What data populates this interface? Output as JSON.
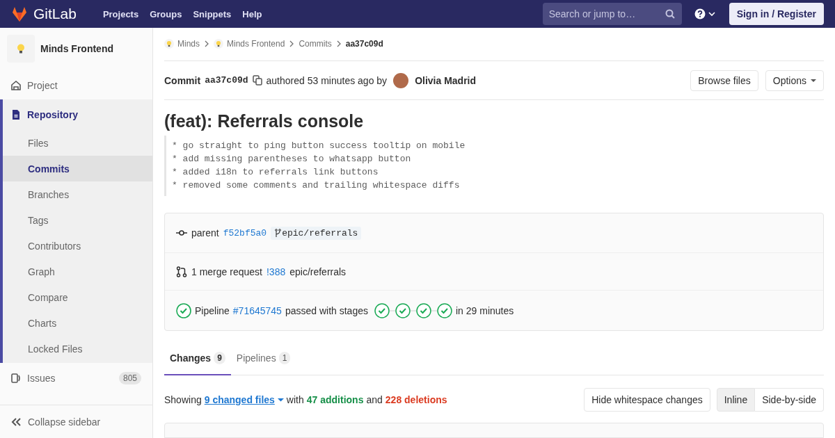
{
  "topbar": {
    "logo": "GitLab",
    "nav": [
      "Projects",
      "Groups",
      "Snippets",
      "Help"
    ],
    "search": {
      "placeholder": "Search or jump to…"
    },
    "signin": "Sign in / Register"
  },
  "sidebar": {
    "project": "Minds Frontend",
    "items": [
      {
        "label": "Project",
        "kind": "project",
        "selected": false
      },
      {
        "label": "Repository",
        "kind": "repository",
        "selected": true,
        "children": [
          {
            "label": "Files",
            "selected": false
          },
          {
            "label": "Commits",
            "selected": true
          },
          {
            "label": "Branches",
            "selected": false
          },
          {
            "label": "Tags",
            "selected": false
          },
          {
            "label": "Contributors",
            "selected": false
          },
          {
            "label": "Graph",
            "selected": false
          },
          {
            "label": "Compare",
            "selected": false
          },
          {
            "label": "Charts",
            "selected": false
          },
          {
            "label": "Locked Files",
            "selected": false
          }
        ]
      },
      {
        "label": "Issues",
        "kind": "issues",
        "selected": false,
        "badge": "805"
      }
    ],
    "collapse": "Collapse sidebar"
  },
  "breadcrumbs": [
    {
      "label": "Minds",
      "avatar": true
    },
    {
      "label": "Minds Frontend",
      "avatar": true
    },
    {
      "label": "Commits",
      "avatar": false
    },
    {
      "label": "aa37c09d",
      "avatar": false
    }
  ],
  "commit_header": {
    "label": "Commit",
    "sha": "aa37c09d",
    "authored": "authored 53 minutes ago by",
    "author": "Olivia Madrid",
    "browse": "Browse files",
    "options": "Options"
  },
  "title": "(feat): Referrals console",
  "description": [
    "* go straight to ping button success tooltip on mobile",
    "* add missing parentheses to whatsapp button",
    "* added i18n to referrals link buttons",
    "* removed some comments and trailing whitespace diffs"
  ],
  "info": {
    "parent_label": "parent",
    "parent_sha": "f52bf5a0",
    "branch": "epic/referrals",
    "mr_text": "1 merge request",
    "mr_link": "!388",
    "mr_branch": "epic/referrals",
    "pipeline_label": "Pipeline",
    "pipeline_link": "#71645745",
    "pipeline_text": "passed with stages",
    "stages": [
      {
        "kind": "passed"
      },
      {
        "kind": "passed"
      },
      {
        "kind": "passed"
      },
      {
        "kind": "passed"
      }
    ],
    "duration": "in 29 minutes"
  },
  "tabs": [
    {
      "label": "Changes",
      "count": "9",
      "selected": true
    },
    {
      "label": "Pipelines",
      "count": "1",
      "selected": false
    }
  ],
  "summary": {
    "showing": "Showing",
    "files": "9 changed files",
    "with": "with",
    "additions": "47 additions",
    "and": "and",
    "deletions": "228 deletions"
  },
  "diff_controls": {
    "whitespace": "Hide whitespace changes",
    "views": [
      {
        "label": "Inline",
        "selected": true
      },
      {
        "label": "Side-by-side",
        "selected": false
      }
    ]
  }
}
